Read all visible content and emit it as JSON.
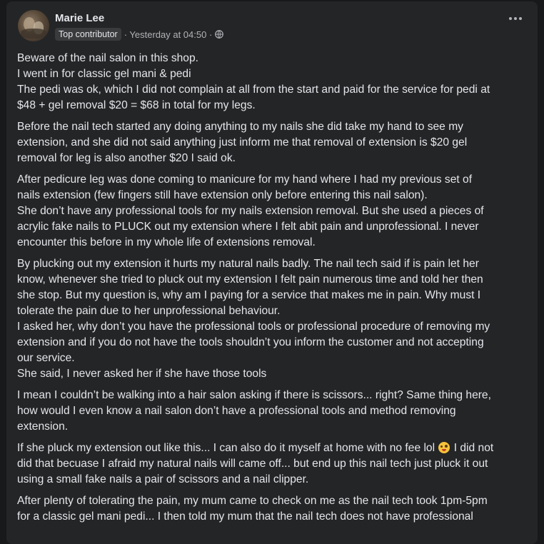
{
  "post": {
    "author": "Marie Lee",
    "badge": "Top contributor",
    "timestamp": "· Yesterday at 04:50 ·",
    "more_icon": "more-horizontal-icon",
    "audience_icon": "globe-icon",
    "paragraphs": [
      [
        "Beware of the nail salon in this shop.",
        "I went in for classic gel mani & pedi",
        "The pedi was ok, which I did not complain at all from the start and paid for the service for pedi at",
        "$48 + gel removal $20 = $68 in total for my legs."
      ],
      [
        "Before the nail tech started any doing anything to my nails she did take my hand to see my",
        "extension, and she did not said anything just inform me that removal of extension is $20 gel",
        "removal for leg is also another $20 I said ok."
      ],
      [
        "After pedicure leg was done coming to manicure for my hand where I had my previous set of",
        "nails extension (few fingers still have extension only before entering this nail salon).",
        "She don’t have any professional tools for my nails extension removal. But she used a pieces of",
        "acrylic fake nails to PLUCK out my extension where I felt abit pain and unprofessional. I never",
        "encounter this before in my whole life of extensions removal."
      ],
      [
        "By plucking out my extension it hurts my natural nails badly. The nail tech said if is pain let her",
        "know, whenever she tried to pluck out my extension I felt pain numerous time and told her then",
        "she stop. But my question is, why am I paying for a service that makes me in pain. Why must I",
        "tolerate the pain due to her unprofessional behaviour.",
        "I asked her, why don’t you have the professional tools or professional procedure of removing my",
        "extension and if you do not have the tools shouldn’t you inform the customer and not accepting",
        "our service.",
        "She said, I never asked her if she have those tools"
      ],
      [
        "I mean I couldn’t be walking into a hair salon asking if there is scissors... right? Same thing here,",
        "how would I even know a nail salon don’t have a professional tools and method removing",
        "extension."
      ],
      [
        "If she pluck my extension out like this... I can also do it myself at home with no fee lol 😜 I did not",
        "did that becuase I afraid my natural nails will came off... but end up this nail tech just pluck it out",
        "using a small fake nails a pair of scissors and a nail clipper."
      ],
      [
        "After plenty of tolerating the pain, my mum came to check on me as the nail tech took 1pm-5pm",
        "for a classic gel mani pedi... I then told my mum that the nail tech does not have professional"
      ]
    ]
  }
}
